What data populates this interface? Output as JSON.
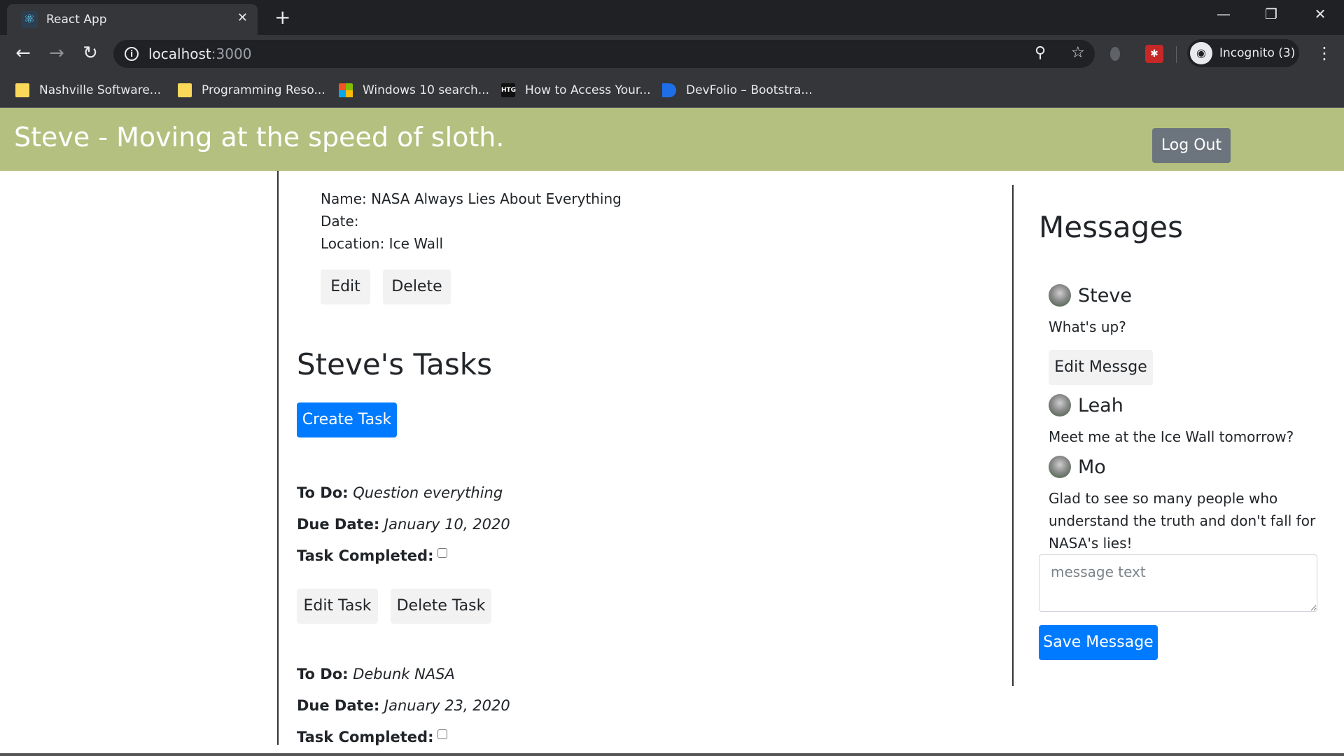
{
  "browser": {
    "tab_title": "React App",
    "url_host": "localhost",
    "url_port": ":3000",
    "profile_label": "Incognito (3)",
    "bookmarks": [
      {
        "label": "Nashville Software...",
        "icon": "folder-icon"
      },
      {
        "label": "Programming Reso...",
        "icon": "folder-icon"
      },
      {
        "label": "Windows 10 search...",
        "icon": "windows-logo-icon"
      },
      {
        "label": "How to Access Your...",
        "icon": "htg-icon"
      },
      {
        "label": "DevFolio – Bootstra...",
        "icon": "devfolio-icon"
      }
    ]
  },
  "header": {
    "title": "Steve - Moving at the speed of sloth.",
    "logout_label": "Log Out",
    "color": "#b3c07f"
  },
  "event": {
    "name_line": "Name: NASA Always Lies About Everything",
    "date_line": "Date:",
    "location_line": "Location: Ice Wall",
    "edit_label": "Edit",
    "delete_label": "Delete"
  },
  "tasks": {
    "heading": "Steve's Tasks",
    "create_label": "Create Task",
    "todo_label": "To Do:",
    "due_label": "Due Date:",
    "completed_label": "Task Completed:",
    "edit_label": "Edit Task",
    "delete_label": "Delete Task",
    "items": [
      {
        "todo": "Question everything",
        "due": "January 10, 2020",
        "completed": false
      },
      {
        "todo": "Debunk NASA",
        "due": "January 23, 2020",
        "completed": false
      }
    ]
  },
  "messages": {
    "heading": "Messages",
    "items": [
      {
        "user": "Steve",
        "text": "What's up?",
        "edit_label": "Edit Messge"
      },
      {
        "user": "Leah",
        "text": "Meet me at the Ice Wall tomorrow?"
      },
      {
        "user": "Mo",
        "text": "Glad to see so many people who understand the truth and don't fall for NASA's lies!"
      }
    ],
    "input_placeholder": "message text",
    "save_label": "Save Message",
    "primary_color": "#007bff"
  }
}
